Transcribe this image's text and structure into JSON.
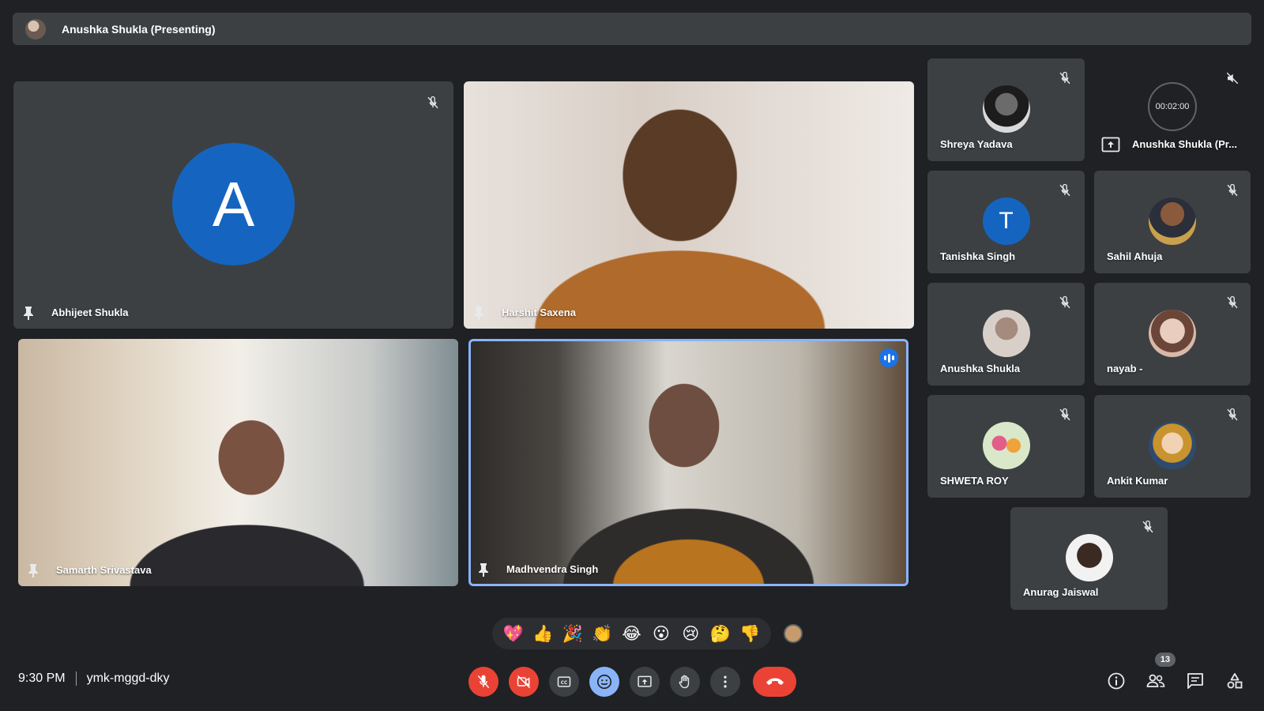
{
  "presenting_bar": {
    "label": "Anushka Shukla (Presenting)"
  },
  "main_tiles": [
    {
      "name": "Abhijeet Shukla",
      "avatar_letter": "A",
      "avatar_color": "#1565c0"
    },
    {
      "name": "Harshit Saxena"
    },
    {
      "name": "Samarth Srivastava"
    },
    {
      "name": "Madhvendra Singh",
      "speaking": true
    }
  ],
  "side_tiles": [
    {
      "name": "Shreya Yadava"
    },
    {
      "name": "Anushka Shukla (Pr...",
      "timer": "00:02:00"
    },
    {
      "name": "Tanishka Singh",
      "avatar_letter": "T",
      "avatar_color": "#1565c0"
    },
    {
      "name": "Sahil Ahuja"
    },
    {
      "name": "Anushka Shukla"
    },
    {
      "name": "nayab -"
    },
    {
      "name": "SHWETA ROY"
    },
    {
      "name": "Ankit Kumar"
    },
    {
      "name": "Anurag Jaiswal"
    }
  ],
  "reactions": [
    "💖",
    "👍",
    "🎉",
    "👏",
    "😂",
    "😮",
    "😢",
    "🤔",
    "👎"
  ],
  "meeting": {
    "time": "9:30 PM",
    "code": "ymk-mggd-dky"
  },
  "participants_count": "13",
  "colors": {
    "bg": "#202124",
    "tile": "#3c4043",
    "danger": "#ea4335",
    "accent": "#8ab4f8"
  }
}
